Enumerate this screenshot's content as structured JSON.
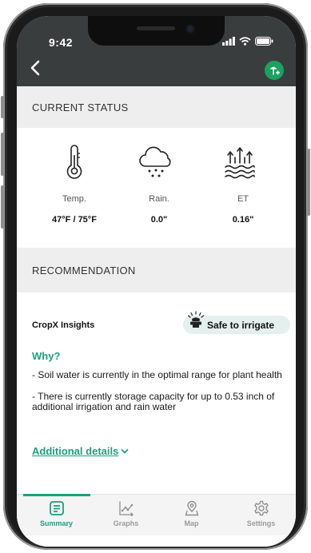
{
  "status_bar": {
    "time": "9:42"
  },
  "current_status": {
    "title": "CURRENT STATUS",
    "metrics": [
      {
        "icon": "thermometer-icon",
        "label": "Temp.",
        "value": "47°F / 75°F"
      },
      {
        "icon": "rain-cloud-icon",
        "label": "Rain.",
        "value": "0.0\""
      },
      {
        "icon": "evapotranspiration-icon",
        "label": "ET",
        "value": "0.16\""
      }
    ]
  },
  "recommendation": {
    "title": "RECOMMENDATION",
    "insights_title": "CropX Insights",
    "badge": "Safe to irrigate",
    "why_label": "Why?",
    "reasons": [
      "- Soil water is currently in the optimal range for plant health",
      "- There is currently storage capacity for up to 0.53 inch of additional irrigation and rain water"
    ],
    "details_link": "Additional details"
  },
  "tabs": [
    {
      "label": "Summary",
      "icon": "summary-icon",
      "active": true
    },
    {
      "label": "Graphs",
      "icon": "graph-icon",
      "active": false
    },
    {
      "label": "Map",
      "icon": "map-pin-icon",
      "active": false
    },
    {
      "label": "Settings",
      "icon": "gear-icon",
      "active": false
    }
  ],
  "colors": {
    "accent": "#1aa27a",
    "header": "#3a3d3e",
    "add_button": "#1aa260",
    "badge_bg": "#e3f0ee",
    "section_bg": "#eeeeee",
    "inactive_tab": "#9a9a9a"
  }
}
